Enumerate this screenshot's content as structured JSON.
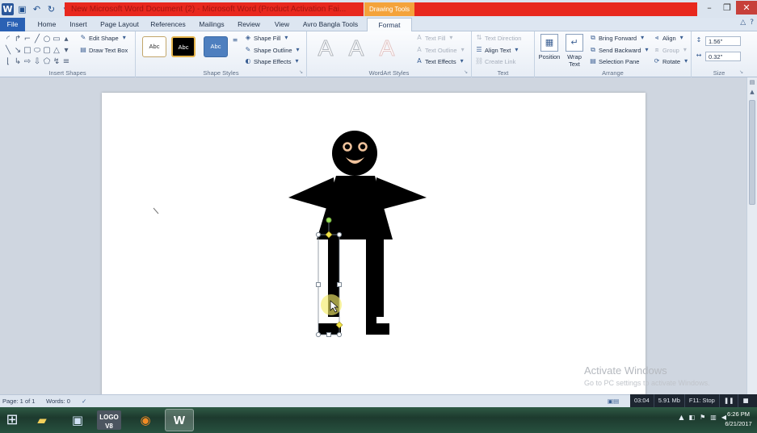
{
  "titlebar": {
    "title": "New Microsoft Word Document (2) - Microsoft Word (Product Activation Fai...",
    "context_tab": "Drawing Tools"
  },
  "tabs": [
    "File",
    "Home",
    "Insert",
    "Page Layout",
    "References",
    "Mailings",
    "Review",
    "View",
    "Avro Bangla Tools",
    "Format"
  ],
  "ribbon": {
    "insert_shapes": {
      "label": "Insert Shapes",
      "edit_shape": "Edit Shape",
      "draw_text_box": "Draw Text Box"
    },
    "shape_styles": {
      "label": "Shape Styles",
      "swatches": [
        "Abc",
        "Abc",
        "Abc"
      ],
      "shape_fill": "Shape Fill",
      "shape_outline": "Shape Outline",
      "shape_effects": "Shape Effects"
    },
    "wordart_styles": {
      "label": "WordArt Styles",
      "letters": [
        "A",
        "A",
        "A"
      ],
      "text_fill": "Text Fill",
      "text_outline": "Text Outline",
      "text_effects": "Text Effects"
    },
    "text": {
      "label": "Text",
      "text_direction": "Text Direction",
      "align_text": "Align Text",
      "create_link": "Create Link"
    },
    "arrange": {
      "label": "Arrange",
      "position": "Position",
      "wrap_text": "Wrap Text",
      "bring_forward": "Bring Forward",
      "send_backward": "Send Backward",
      "selection_pane": "Selection Pane",
      "align": "Align",
      "group": "Group",
      "rotate": "Rotate"
    },
    "size": {
      "label": "Size",
      "height": "1.56\"",
      "width": "0.32\""
    }
  },
  "status": {
    "page": "Page: 1 of 1",
    "words": "Words: 0"
  },
  "recorder": {
    "time": "03:04",
    "filesize": "5.91 Mb",
    "stop_hint": "F11: Stop"
  },
  "watermark": {
    "line1": "Activate Windows",
    "line2": "Go to PC settings to activate Windows."
  },
  "clock": {
    "time": "6:26 PM",
    "date": "6/21/2017"
  },
  "taskbar": {
    "logo_app": "LOGO V8"
  },
  "colors": {
    "title_red": "#e8281e",
    "context_orange": "#f4a33b",
    "file_tab": "#2a61b4",
    "taskbar": "#1d3a2e"
  }
}
